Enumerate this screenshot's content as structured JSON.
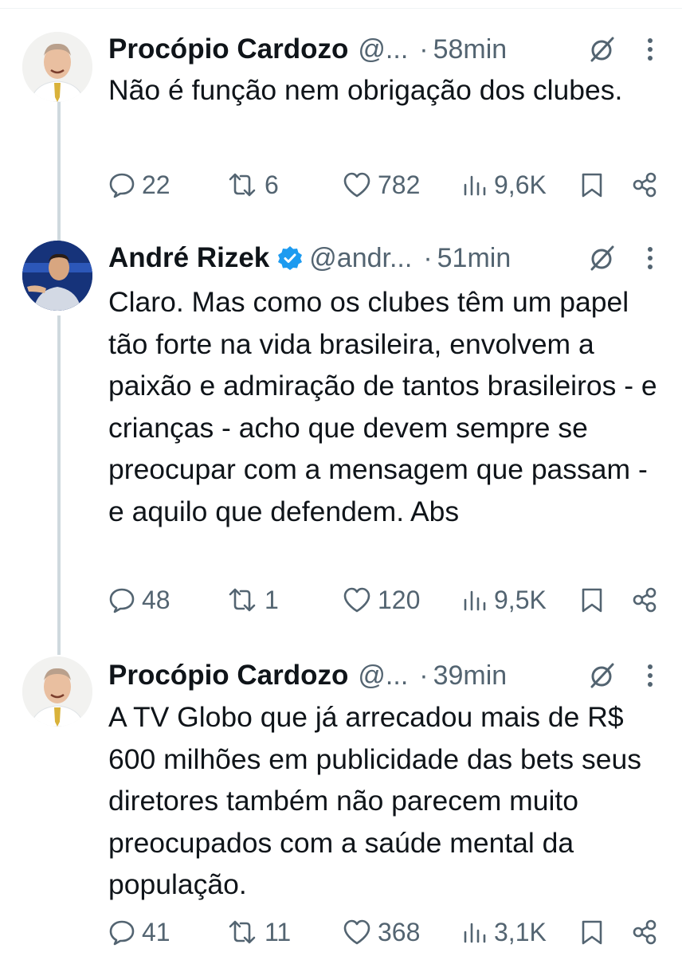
{
  "tweets": [
    {
      "name": "Procópio Cardozo",
      "verified": false,
      "handle": "@...",
      "time": "58min",
      "text": "Não é função nem obrigação dos clubes.",
      "replies": "22",
      "reposts": "6",
      "likes": "782",
      "views": "9,6K",
      "icons": [
        "grok-icon",
        "more-icon",
        "reply-icon",
        "repost-icon",
        "like-icon",
        "views-icon",
        "bookmark-icon",
        "share-icon"
      ]
    },
    {
      "name": "André Rizek",
      "verified": true,
      "handle": "@andr...",
      "time": "51min",
      "text": "Claro. Mas como os clubes têm um papel tão forte na vida brasileira, envolvem a paixão e admiração de tantos brasileiros - e crianças - acho que devem sempre se preocupar com a mensagem que passam - e aquilo que defendem. Abs",
      "replies": "48",
      "reposts": "1",
      "likes": "120",
      "views": "9,5K",
      "icons": [
        "grok-icon",
        "more-icon",
        "reply-icon",
        "repost-icon",
        "like-icon",
        "views-icon",
        "bookmark-icon",
        "share-icon"
      ]
    },
    {
      "name": "Procópio Cardozo",
      "verified": false,
      "handle": "@...",
      "time": "39min",
      "text": "A TV Globo que já arrecadou mais de R$ 600 milhões em publicidade das bets seus diretores também não parecem muito preocupados com a saúde mental da população.",
      "replies": "41",
      "reposts": "11",
      "likes": "368",
      "views": "3,1K",
      "icons": [
        "grok-icon",
        "more-icon",
        "reply-icon",
        "repost-icon",
        "like-icon",
        "views-icon",
        "bookmark-icon",
        "share-icon"
      ]
    }
  ],
  "colors": {
    "text": "#0f1419",
    "secondary": "#536471",
    "thread_line": "#cfd9de",
    "verified": "#1d9bf0"
  }
}
